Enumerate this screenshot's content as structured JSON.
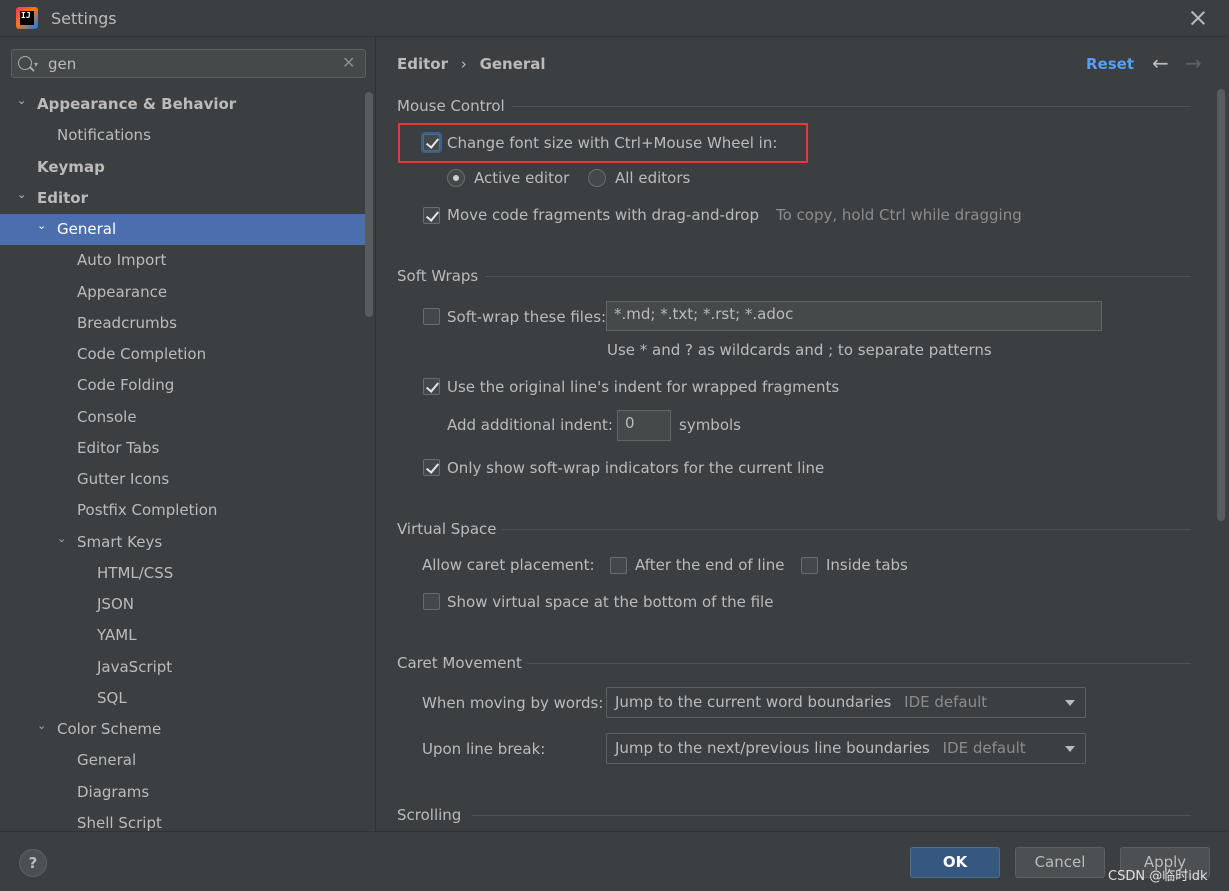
{
  "window": {
    "title": "Settings"
  },
  "search": {
    "value": "gen"
  },
  "sidebar": {
    "items": [
      {
        "label": "Appearance & Behavior",
        "arrow": "⌄"
      },
      {
        "label": "Notifications",
        "arrow": ""
      },
      {
        "label": "Keymap",
        "arrow": ""
      },
      {
        "label": "Editor",
        "arrow": "⌄"
      },
      {
        "label": "General",
        "arrow": "⌄"
      },
      {
        "label": "Auto Import",
        "arrow": ""
      },
      {
        "label": "Appearance",
        "arrow": ""
      },
      {
        "label": "Breadcrumbs",
        "arrow": ""
      },
      {
        "label": "Code Completion",
        "arrow": ""
      },
      {
        "label": "Code Folding",
        "arrow": ""
      },
      {
        "label": "Console",
        "arrow": ""
      },
      {
        "label": "Editor Tabs",
        "arrow": ""
      },
      {
        "label": "Gutter Icons",
        "arrow": ""
      },
      {
        "label": "Postfix Completion",
        "arrow": ""
      },
      {
        "label": "Smart Keys",
        "arrow": "⌄"
      },
      {
        "label": "HTML/CSS",
        "arrow": ""
      },
      {
        "label": "JSON",
        "arrow": ""
      },
      {
        "label": "YAML",
        "arrow": ""
      },
      {
        "label": "JavaScript",
        "arrow": ""
      },
      {
        "label": "SQL",
        "arrow": ""
      },
      {
        "label": "Color Scheme",
        "arrow": "⌄"
      },
      {
        "label": "General",
        "arrow": ""
      },
      {
        "label": "Diagrams",
        "arrow": ""
      },
      {
        "label": "Shell Script",
        "arrow": ""
      }
    ]
  },
  "header": {
    "crumb1": "Editor",
    "sep": "›",
    "crumb2": "General",
    "reset": "Reset",
    "back": "←",
    "forward": "→"
  },
  "mouse_control": {
    "title": "Mouse Control",
    "change_font": {
      "label": "Change font size with Ctrl+Mouse Wheel in:",
      "checked": true
    },
    "active_editor": "Active editor",
    "all_editors": "All editors",
    "move_code": {
      "label": "Move code fragments with drag-and-drop",
      "checked": true
    },
    "move_hint": "To copy, hold Ctrl while dragging"
  },
  "soft_wraps": {
    "title": "Soft Wraps",
    "softwrap_label": "Soft-wrap these files:",
    "softwrap_value": "*.md; *.txt; *.rst; *.adoc",
    "softwrap_hint": "Use * and ? as wildcards and ; to separate patterns",
    "use_indent": "Use the original line's indent for wrapped fragments",
    "add_indent_label": "Add additional indent:",
    "add_indent_value": "0",
    "symbols": "symbols",
    "only_show": "Only show soft-wrap indicators for the current line"
  },
  "virtual_space": {
    "title": "Virtual Space",
    "allow_caret": "Allow caret placement:",
    "after_end": "After the end of line",
    "inside_tabs": "Inside tabs",
    "show_virtual": "Show virtual space at the bottom of the file"
  },
  "caret_movement": {
    "title": "Caret Movement",
    "words_label": "When moving by words:",
    "words_value": "Jump to the current word boundaries",
    "words_default": "IDE default",
    "break_label": "Upon line break:",
    "break_value": "Jump to the next/previous line boundaries",
    "break_default": "IDE default"
  },
  "scrolling": {
    "title": "Scrolling"
  },
  "footer": {
    "help": "?",
    "ok": "OK",
    "cancel": "Cancel",
    "apply": "Apply"
  },
  "watermark": "CSDN @临时idk",
  "colors": {
    "selection": "#4b6eaf",
    "link": "#589df6",
    "highlight_box": "#e53935"
  }
}
